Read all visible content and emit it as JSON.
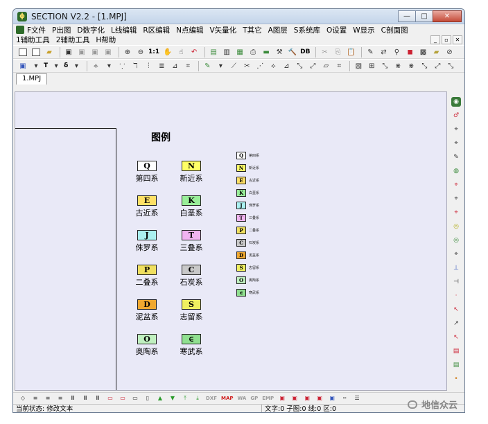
{
  "window": {
    "title": "SECTION V2.2 - [1.MPJ]",
    "app_icon": "app-logo-icon"
  },
  "menu": {
    "row1": [
      "F文件",
      "P出图",
      "D数字化",
      "L线编辑",
      "R区编辑",
      "N点编辑",
      "V矢量化",
      "T其它",
      "A图层",
      "S系统库",
      "O设置",
      "W显示",
      "C剖面图"
    ],
    "row2": [
      "1辅助工具",
      "2辅助工具",
      "H帮助"
    ]
  },
  "toolbar": {
    "db_label": "DB",
    "text_label": "T",
    "delta_label": "δ",
    "zoom_label": "1:1"
  },
  "doc_tabs": [
    "1.MPJ"
  ],
  "legend": {
    "title": "图例",
    "items": [
      {
        "code": "Q",
        "label": "第四系",
        "color": "#ffffff"
      },
      {
        "code": "N",
        "label": "新近系",
        "color": "#ffff66"
      },
      {
        "code": "E",
        "label": "古近系",
        "color": "#ffe066"
      },
      {
        "code": "K",
        "label": "白垩系",
        "color": "#99ee99"
      },
      {
        "code": "J",
        "label": "侏罗系",
        "color": "#aaf0f0"
      },
      {
        "code": "T",
        "label": "三叠系",
        "color": "#f0b3f0"
      },
      {
        "code": "P",
        "label": "二叠系",
        "color": "#f0e060"
      },
      {
        "code": "C",
        "label": "石炭系",
        "color": "#c8c8c8"
      },
      {
        "code": "D",
        "label": "泥盆系",
        "color": "#f0a830"
      },
      {
        "code": "S",
        "label": "志留系",
        "color": "#f0f060"
      },
      {
        "code": "O",
        "label": "奥陶系",
        "color": "#c0f0c0"
      },
      {
        "code": "∈",
        "label": "寒武系",
        "color": "#90e090"
      }
    ]
  },
  "bottom_toolbar": {
    "dxf": "DXF",
    "map": "MAP",
    "wa": "WA",
    "gp": "GP",
    "emp": "EMP"
  },
  "status": {
    "left": "当前状态: 修改文本",
    "counts": "文字:0 子图:0 线:0 区:0"
  },
  "watermark": "地信众云"
}
